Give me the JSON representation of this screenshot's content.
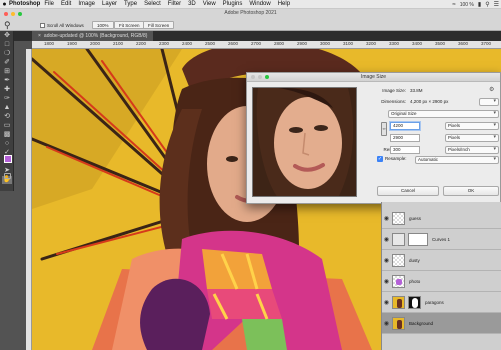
{
  "menubar": {
    "app_name": "Photoshop",
    "items": [
      "File",
      "Edit",
      "Image",
      "Layer",
      "Type",
      "Select",
      "Filter",
      "3D",
      "View",
      "Plugins",
      "Window",
      "Help"
    ],
    "battery": "100 %"
  },
  "options_bar": {
    "doc_title": "Adobe Photoshop 2021",
    "scroll_all_windows": "Scroll All Windows",
    "zoom_100": "100%",
    "fit_screen": "Fit Screen",
    "fill_screen": "Fill Screen"
  },
  "document": {
    "tab_title": "adobe-updated @ 100% (Background, RGB/8)",
    "ruler_ticks": [
      "1800",
      "1900",
      "2000",
      "2100",
      "2200",
      "2300",
      "2400",
      "2500",
      "2600",
      "2700",
      "2800",
      "2900",
      "3000",
      "3100",
      "3200",
      "3300",
      "3400",
      "3500",
      "3600",
      "3700"
    ]
  },
  "dialog": {
    "title": "Image Size",
    "image_size_label": "Image Size:",
    "image_size_value": "33.8M",
    "dimensions_label": "Dimensions:",
    "dimensions_value": "4,200 px  ×  2900 px",
    "fit_to_label": "Fit To:",
    "fit_to_value": "Original Size",
    "width_label": "Width:",
    "width_value": "4200",
    "width_unit": "Pixels",
    "height_label": "Height:",
    "height_value": "2900",
    "height_unit": "Pixels",
    "resolution_label": "Resolution:",
    "resolution_value": "300",
    "resolution_unit": "Pixels/Inch",
    "resample_label": "Resample:",
    "resample_value": "Automatic",
    "cancel_label": "Cancel",
    "ok_label": "OK"
  },
  "layers": [
    {
      "name": "guess",
      "selected": false
    },
    {
      "name": "Curves 1",
      "selected": false
    },
    {
      "name": "dusty",
      "selected": false
    },
    {
      "name": "photo",
      "selected": false
    },
    {
      "name": "paragons",
      "selected": false
    },
    {
      "name": "Background",
      "selected": true
    }
  ],
  "colors": {
    "foreground": "#b561d8",
    "background": "#ffffff",
    "canvas_yellow": "#e8b92a"
  }
}
